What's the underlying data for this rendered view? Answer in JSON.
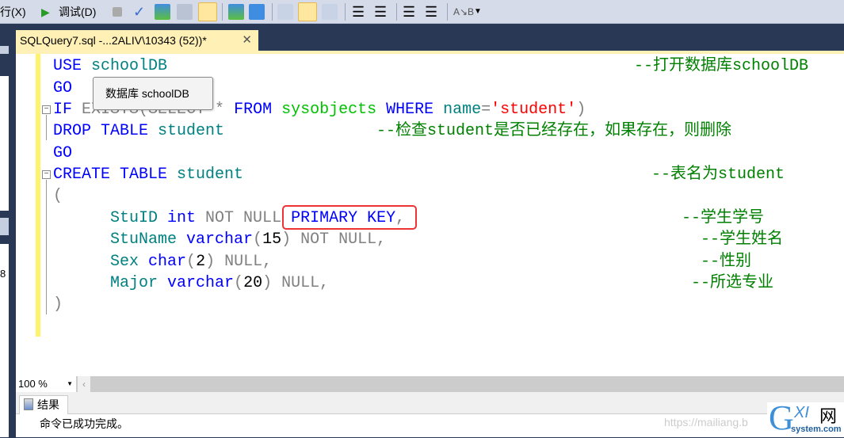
{
  "toolbar": {
    "execute_label": "行(X)",
    "debug_label": "调试(D)",
    "icons": [
      "stop-icon",
      "parse-check-icon",
      "query-design-icon",
      "specify-values-icon",
      "results-to-file-icon",
      "estimated-plan-icon",
      "client-stats-icon",
      "results-to-text-icon",
      "results-to-grid-icon",
      "results-to-file2-icon",
      "comment-icon",
      "uncomment-icon",
      "decrease-indent-icon",
      "increase-indent-icon",
      "template-params-icon",
      "overflow-icon"
    ]
  },
  "tab": {
    "title": "SQLQuery7.sql -...2ALIV\\10343 (52))*",
    "close": "✕"
  },
  "left_panel_text": "8",
  "tooltip": "数据库 schoolDB",
  "code": [
    {
      "parts": [
        [
          "kw",
          "USE"
        ],
        [
          "id",
          " schoolDB"
        ]
      ],
      "comment": "--打开数据库schoolDB"
    },
    {
      "parts": [
        [
          "kw",
          "GO"
        ]
      ],
      "comment": ""
    },
    {
      "parts": [
        [
          "kw",
          "IF"
        ],
        [
          "gr",
          " EXISTS(SELECT"
        ],
        [
          "gr",
          " *"
        ],
        [
          "kw",
          " FROM"
        ],
        [
          "sys",
          " sysobjects"
        ],
        [
          "kw",
          " WHERE"
        ],
        [
          "id",
          " name"
        ],
        [
          "gr",
          "="
        ],
        [
          "str",
          "'student'"
        ],
        [
          "gr",
          ")"
        ]
      ],
      "comment": ""
    },
    {
      "parts": [
        [
          "kw",
          "DROP"
        ],
        [
          "kw",
          " TABLE"
        ],
        [
          "id",
          " student"
        ]
      ],
      "comment": "--检查student是否已经存在，如果存在，则删除"
    },
    {
      "parts": [
        [
          "kw",
          "GO"
        ]
      ],
      "comment": ""
    },
    {
      "parts": [
        [
          "kw",
          "CREATE"
        ],
        [
          "kw",
          " TABLE"
        ],
        [
          "id",
          " student"
        ]
      ],
      "comment": "--表名为student"
    },
    {
      "parts": [
        [
          "gr",
          "("
        ]
      ],
      "comment": ""
    },
    {
      "parts": [
        [
          "id",
          "      StuID"
        ],
        [
          "kw",
          " int"
        ],
        [
          "gr",
          " NOT NULL"
        ],
        [
          "kw",
          " PRIMARY KEY"
        ],
        [
          "gr",
          ","
        ]
      ],
      "comment": "--学生学号"
    },
    {
      "parts": [
        [
          "id",
          "      StuName"
        ],
        [
          "kw",
          " varchar"
        ],
        [
          "gr",
          "("
        ],
        [
          "bk",
          "15"
        ],
        [
          "gr",
          ")"
        ],
        [
          "gr",
          " NOT NULL,"
        ]
      ],
      "comment": "--学生姓名"
    },
    {
      "parts": [
        [
          "id",
          "      Sex"
        ],
        [
          "kw",
          " char"
        ],
        [
          "gr",
          "("
        ],
        [
          "bk",
          "2"
        ],
        [
          "gr",
          ")"
        ],
        [
          "gr",
          " NULL,"
        ]
      ],
      "comment": "--性别"
    },
    {
      "parts": [
        [
          "id",
          "      Major"
        ],
        [
          "kw",
          " varchar"
        ],
        [
          "gr",
          "("
        ],
        [
          "bk",
          "20"
        ],
        [
          "gr",
          ")"
        ],
        [
          "gr",
          " NULL,"
        ]
      ],
      "comment": "--所选专业"
    },
    {
      "parts": [
        [
          "gr",
          ")"
        ]
      ],
      "comment": ""
    }
  ],
  "zoom": {
    "value": "100 %"
  },
  "results": {
    "tab_label": "结果",
    "message": "命令已成功完成。",
    "watermark": "https://mailiang.b"
  },
  "logo": {
    "text": "GXI网",
    "sub": "system.com"
  },
  "colors": {
    "keyword": "#0000ff",
    "identifier": "#008080",
    "comment": "#008000",
    "string": "#ff0000",
    "highlight": "#e33333"
  }
}
